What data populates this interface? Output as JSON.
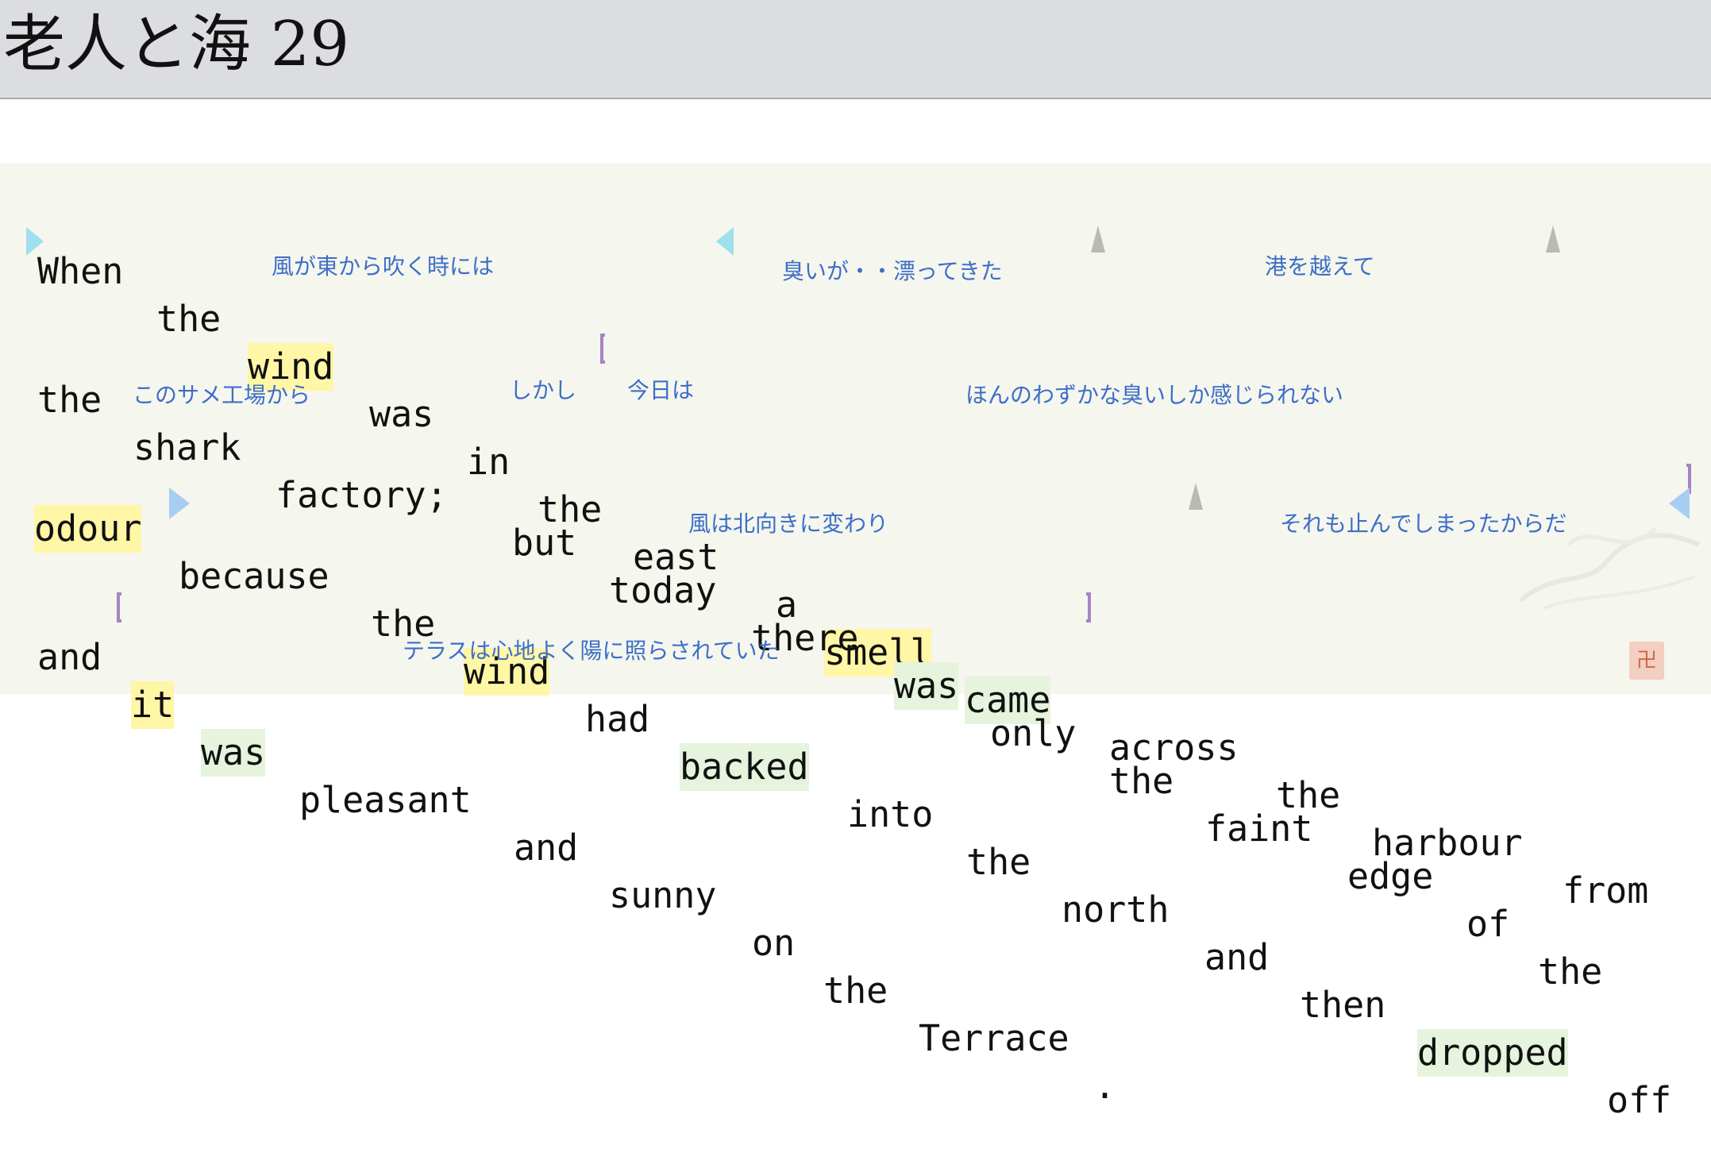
{
  "title": "老人と海 29",
  "lines": [
    {
      "words": [
        "When",
        "the",
        "wind",
        "was",
        "in",
        "the",
        "east",
        "a",
        "smell",
        "came",
        "across",
        "the",
        "harbour",
        "from"
      ],
      "notes": [
        "風が東から吹く時には",
        "臭いが・・漂ってきた",
        "港を越えて"
      ]
    },
    {
      "words": [
        "the",
        "shark",
        "factory;",
        "but",
        "today",
        "there",
        "was",
        "only",
        "the",
        "faint",
        "edge",
        "of",
        "the"
      ],
      "notes": [
        "このサメ工場から",
        "しかし",
        "今日は",
        "ほんのわずかな臭いしか感じられない"
      ]
    },
    {
      "words": [
        "odour",
        "because",
        "the",
        "wind",
        "had",
        "backed",
        "into",
        "the",
        "north",
        "and",
        "then",
        "dropped",
        "off"
      ],
      "notes": [
        "風は北向きに変わり",
        "それも止んでしまったからだ"
      ]
    },
    {
      "words": [
        "and",
        "it",
        "was",
        "pleasant",
        "and",
        "sunny",
        "on",
        "the",
        "Terrace",
        "."
      ],
      "notes": [
        "テラスは心地よく陽に照らされていた"
      ]
    }
  ],
  "colors": {
    "highlight_yellow": "#fff6a6",
    "highlight_green": "#e6f4de",
    "annotation_blue": "#3d6ec8",
    "bracket_purple": "#a783c4",
    "content_background": "#f5f6ee",
    "titlebar_background": "#dcdde0"
  },
  "icons": {
    "stamp": "seal-stamp-icon",
    "signature": "signature-watermark"
  }
}
